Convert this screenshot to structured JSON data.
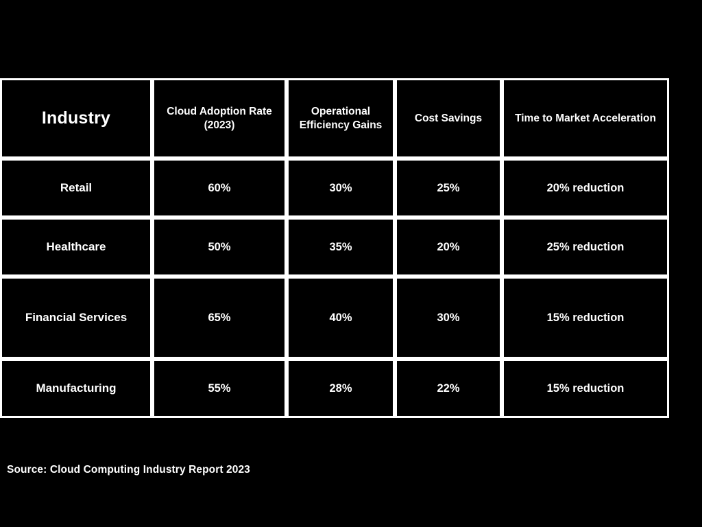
{
  "slide": {
    "background_color": "#000000",
    "accent_color": "#8A0ACA",
    "text_color": "#FFFFFF",
    "border_color": "#FFFFFF"
  },
  "table": {
    "headers": [
      "Industry",
      "Cloud Adoption Rate (2023)",
      "Operational Efficiency Gains",
      "Cost Savings",
      "Time to Market Acceleration"
    ],
    "rows": [
      {
        "industry": "Retail",
        "cloud_adoption_rate": "60%",
        "operational_efficiency_gains": "30%",
        "cost_savings": "25%",
        "time_to_market_acceleration": "20% reduction"
      },
      {
        "industry": "Healthcare",
        "cloud_adoption_rate": "50%",
        "operational_efficiency_gains": "35%",
        "cost_savings": "20%",
        "time_to_market_acceleration": "25% reduction"
      },
      {
        "industry": "Financial Services",
        "cloud_adoption_rate": "65%",
        "operational_efficiency_gains": "40%",
        "cost_savings": "30%",
        "time_to_market_acceleration": "15% reduction"
      },
      {
        "industry": "Manufacturing",
        "cloud_adoption_rate": "55%",
        "operational_efficiency_gains": "28%",
        "cost_savings": "22%",
        "time_to_market_acceleration": "15% reduction"
      }
    ]
  },
  "source": {
    "label": "Source: Cloud Computing Industry Report 2023"
  },
  "chart_data": {
    "type": "table",
    "title": "",
    "columns": [
      "Industry",
      "Cloud Adoption Rate (2023)",
      "Operational Efficiency Gains",
      "Cost Savings",
      "Time to Market Acceleration"
    ],
    "categories": [
      "Retail",
      "Healthcare",
      "Financial Services",
      "Manufacturing"
    ],
    "series": [
      {
        "name": "Cloud Adoption Rate (2023)",
        "values": [
          60,
          50,
          65,
          55
        ],
        "unit": "%"
      },
      {
        "name": "Operational Efficiency Gains",
        "values": [
          30,
          35,
          40,
          28
        ],
        "unit": "%"
      },
      {
        "name": "Cost Savings",
        "values": [
          25,
          20,
          30,
          22
        ],
        "unit": "%"
      },
      {
        "name": "Time to Market Acceleration",
        "values": [
          20,
          25,
          15,
          15
        ],
        "unit": "% reduction"
      }
    ],
    "source": "Source: Cloud Computing Industry Report 2023"
  }
}
